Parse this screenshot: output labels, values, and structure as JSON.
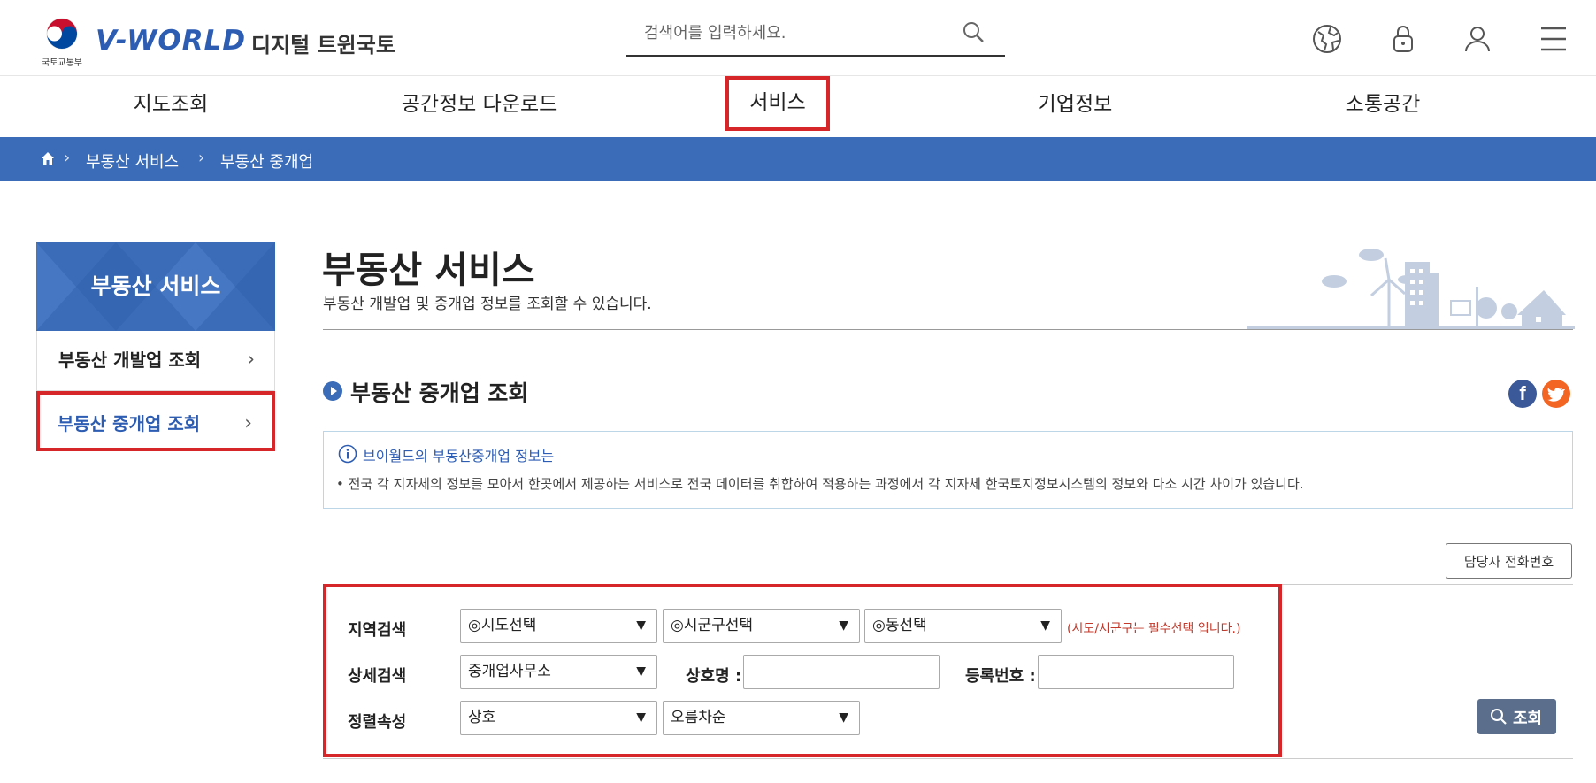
{
  "header": {
    "emblem_text": "국토교통부",
    "logo_main": "V-WORLD",
    "logo_sub": "디지털 트윈국토",
    "search_placeholder": "검색어를 입력하세요."
  },
  "icons": {
    "search": "search-icon",
    "globe": "globe-icon",
    "lock": "lock-icon",
    "user": "user-icon",
    "menu": "hamburger-icon",
    "home": "home-icon",
    "facebook": "facebook-icon",
    "twitter": "twitter-icon",
    "info": "info-icon"
  },
  "gnb": {
    "items": [
      {
        "label": "지도조회"
      },
      {
        "label": "공간정보 다운로드"
      },
      {
        "label": "서비스"
      },
      {
        "label": "기업정보"
      },
      {
        "label": "소통공간"
      }
    ]
  },
  "breadcrumb": {
    "items": [
      "부동산 서비스",
      "부동산 중개업"
    ]
  },
  "side": {
    "title": "부동산 서비스",
    "items": [
      {
        "label": "부동산 개발업 조회"
      },
      {
        "label": "부동산 중개업 조회"
      }
    ]
  },
  "main": {
    "title": "부동산 서비스",
    "desc": "부동산 개발업 및 중개업 정보를 조회할 수 있습니다.",
    "section_title": "부동산 중개업 조회",
    "facebook_letter": "f",
    "info": {
      "title": "브이월드의 부동산중개업 정보는",
      "text": "• 전국 각 지자체의 정보를 모아서 한곳에서 제공하는 서비스로 전국 데이터를 취합하여 적용하는 과정에서 각 지자체 한국토지정보시스템의 정보와 다소 시간 차이가 있습니다."
    },
    "phone_button": "담당자 전화번호"
  },
  "form": {
    "region_label": "지역검색",
    "sido": "◎시도선택",
    "sigungu": "◎시군구선택",
    "dong": "◎동선택",
    "note": "(시도/시군구는 필수선택 입니다.)",
    "detail_label": "상세검색",
    "detail_value": "중개업사무소",
    "company_label": "상호명 :",
    "company_value": "",
    "regno_label": "등록번호 :",
    "regno_value": "",
    "sort_label": "정렬속성",
    "sort_field": "상호",
    "sort_order": "오름차순",
    "arrow": "▼",
    "submit": "조회"
  },
  "colors": {
    "brand_blue": "#3b6cb7",
    "highlight_red": "#d6262a",
    "submit_bg": "#5b6e8c"
  }
}
